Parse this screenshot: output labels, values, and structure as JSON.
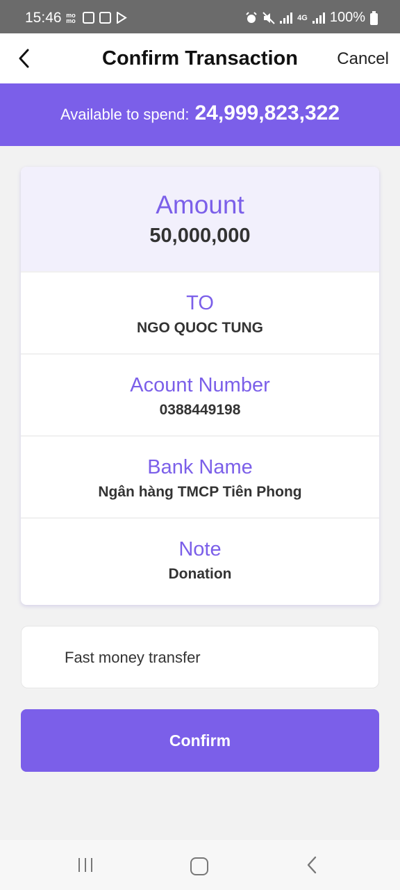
{
  "status_bar": {
    "time": "15:46",
    "left_icons": [
      "momo-icon",
      "checkbox-icon",
      "image-icon",
      "play-store-icon"
    ],
    "right_icons": [
      "alarm-icon",
      "mute-icon",
      "signal-icon",
      "4g-icon",
      "signal-icon",
      "battery-icon"
    ],
    "network": "4G",
    "battery": "100%"
  },
  "header": {
    "title": "Confirm Transaction",
    "cancel_label": "Cancel",
    "back_icon": "chevron-left-icon"
  },
  "balance": {
    "label": "Available to spend:",
    "value": "24,999,823,322"
  },
  "details": {
    "amount_label": "Amount",
    "amount_value": "50,000,000",
    "rows": [
      {
        "label": "TO",
        "value": "NGO QUOC TUNG"
      },
      {
        "label": "Acount Number",
        "value": "0388449198"
      },
      {
        "label": "Bank Name",
        "value": "Ngân hàng TMCP Tiên Phong"
      },
      {
        "label": "Note",
        "value": "Donation"
      }
    ]
  },
  "transfer_type": {
    "label": "Fast money transfer"
  },
  "confirm_label": "Confirm",
  "colors": {
    "accent": "#7b5fe9",
    "amount_bg": "#f2f0fc",
    "page_bg": "#f2f2f2",
    "status_bar": "#6b6b6b"
  }
}
